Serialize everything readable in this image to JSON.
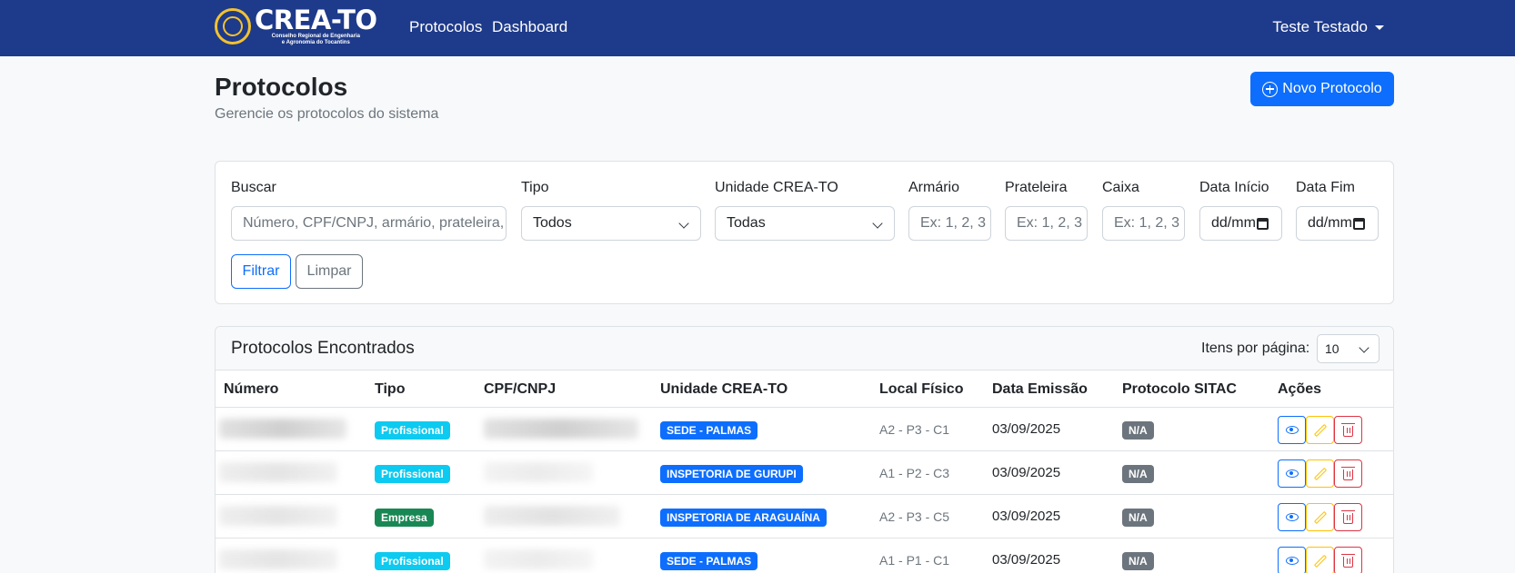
{
  "navbar": {
    "brand_name": "CREA-TO",
    "brand_sub_1": "Conselho Regional de Engenharia",
    "brand_sub_2": "e Agronomia do Tocantins",
    "links": [
      "Protocolos",
      "Dashboard"
    ],
    "user": "Teste Testado"
  },
  "header": {
    "title": "Protocolos",
    "subtitle": "Gerencie os protocolos do sistema",
    "new_button": "Novo Protocolo"
  },
  "filters": {
    "search_label": "Buscar",
    "search_placeholder": "Número, CPF/CNPJ, armário, prateleira,",
    "type_label": "Tipo",
    "type_value": "Todos",
    "unit_label": "Unidade CREA-TO",
    "unit_value": "Todas",
    "cabinet_label": "Armário",
    "cabinet_placeholder": "Ex: 1, 2, 3",
    "shelf_label": "Prateleira",
    "shelf_placeholder": "Ex: 1, 2, 3",
    "box_label": "Caixa",
    "box_placeholder": "Ex: 1, 2, 3",
    "start_label": "Data Início",
    "start_value": "dd/mm",
    "end_label": "Data Fim",
    "end_value": "dd/mm",
    "filter_button": "Filtrar",
    "clear_button": "Limpar"
  },
  "results": {
    "title": "Protocolos Encontrados",
    "per_page_label": "Itens por página:",
    "per_page_value": "10",
    "columns": [
      "Número",
      "Tipo",
      "CPF/CNPJ",
      "Unidade CREA-TO",
      "Local Físico",
      "Data Emissão",
      "Protocolo SITAC",
      "Ações"
    ],
    "rows": [
      {
        "tipo": "Profissional",
        "unidade": "SEDE - PALMAS",
        "local": "A2 - P3 - C1",
        "data": "03/09/2025",
        "sitac": "N/A"
      },
      {
        "tipo": "Profissional",
        "unidade": "INSPETORIA DE GURUPI",
        "local": "A1 - P2 - C3",
        "data": "03/09/2025",
        "sitac": "N/A"
      },
      {
        "tipo": "Empresa",
        "unidade": "INSPETORIA DE ARAGUAÍNA",
        "local": "A2 - P3 - C5",
        "data": "03/09/2025",
        "sitac": "N/A"
      },
      {
        "tipo": "Profissional",
        "unidade": "SEDE - PALMAS",
        "local": "A1 - P1 - C1",
        "data": "03/09/2025",
        "sitac": "N/A"
      }
    ]
  },
  "colors": {
    "navbar": "#1e3a8a",
    "primary": "#0d6efd",
    "info": "#0dcaf0",
    "success": "#198754",
    "secondary": "#6c757d",
    "warning": "#ffc107",
    "danger": "#dc3545"
  }
}
